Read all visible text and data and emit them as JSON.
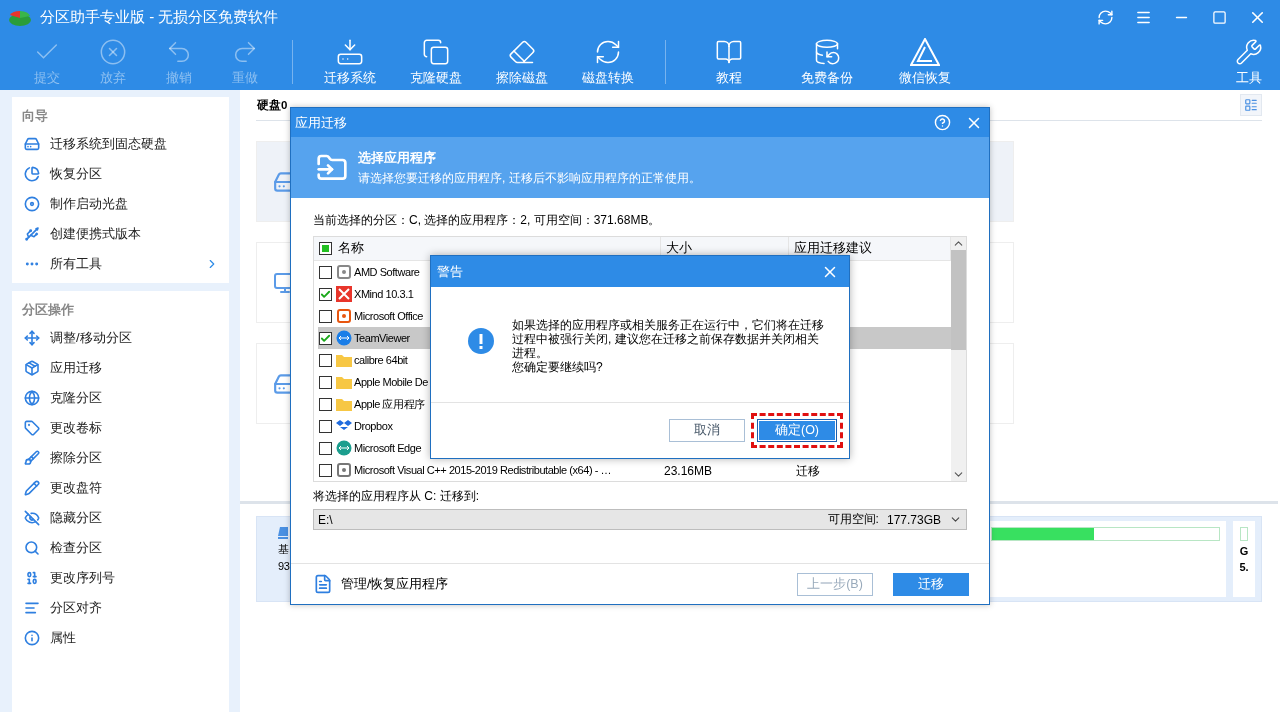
{
  "app": {
    "title": "分区助手专业版 - 无损分区免费软件"
  },
  "toolbar": {
    "groups": [
      [
        {
          "label": "提交",
          "disabled": true
        },
        {
          "label": "放弃",
          "disabled": true
        },
        {
          "label": "撤销",
          "disabled": true
        },
        {
          "label": "重做",
          "disabled": true
        }
      ],
      [
        {
          "label": "迁移系统",
          "disabled": false
        },
        {
          "label": "克隆硬盘",
          "disabled": false
        },
        {
          "label": "擦除磁盘",
          "disabled": false
        },
        {
          "label": "磁盘转换",
          "disabled": false
        }
      ],
      [
        {
          "label": "教程",
          "disabled": false
        },
        {
          "label": "免费备份",
          "disabled": false
        },
        {
          "label": "微信恢复",
          "disabled": false
        }
      ]
    ],
    "tools": {
      "label": "工具"
    }
  },
  "sidebar": {
    "sections": [
      {
        "heading": "向导",
        "items": [
          {
            "label": "迁移系统到固态硬盘",
            "has_submenu": false
          },
          {
            "label": "恢复分区",
            "has_submenu": false
          },
          {
            "label": "制作启动光盘",
            "has_submenu": false
          },
          {
            "label": "创建便携式版本",
            "has_submenu": false
          },
          {
            "label": "所有工具",
            "has_submenu": true
          }
        ]
      },
      {
        "heading": "分区操作",
        "items": [
          {
            "label": "调整/移动分区",
            "has_submenu": false
          },
          {
            "label": "应用迁移",
            "has_submenu": false
          },
          {
            "label": "克隆分区",
            "has_submenu": false
          },
          {
            "label": "更改卷标",
            "has_submenu": false
          },
          {
            "label": "擦除分区",
            "has_submenu": false
          },
          {
            "label": "更改盘符",
            "has_submenu": false
          },
          {
            "label": "隐藏分区",
            "has_submenu": false
          },
          {
            "label": "检查分区",
            "has_submenu": false
          },
          {
            "label": "更改序列号",
            "has_submenu": false
          },
          {
            "label": "分区对齐",
            "has_submenu": false
          },
          {
            "label": "属性",
            "has_submenu": false
          }
        ]
      }
    ]
  },
  "disk_view": {
    "title": "硬盘0"
  },
  "disk_panel": {
    "name": "基",
    "size": "93",
    "partition": {
      "level": 0.45
    },
    "side": {
      "letter": "G",
      "size": "5."
    }
  },
  "migrate_dialog": {
    "title": "应用迁移",
    "header": {
      "title": "选择应用程序",
      "subtitle": "请选择您要迁移的应用程序, 迁移后不影响应用程序的正常使用。"
    },
    "summary": "当前选择的分区：C, 选择的应用程序：2, 可用空间：371.68MB。",
    "check_all_mixed": true,
    "columns": [
      "名称",
      "大小",
      "应用迁移建议"
    ],
    "rows": [
      {
        "name": "AMD Software",
        "checked": false,
        "selected": false
      },
      {
        "name": "XMind 10.3.1",
        "checked": true,
        "selected": false
      },
      {
        "name": "Microsoft Office",
        "checked": false,
        "selected": false
      },
      {
        "name": "TeamViewer",
        "checked": true,
        "selected": true
      },
      {
        "name": "calibre 64bit",
        "checked": false,
        "selected": false
      },
      {
        "name": "Apple Mobile De",
        "checked": false,
        "selected": false
      },
      {
        "name": "Apple 应用程序",
        "checked": false,
        "selected": false
      },
      {
        "name": "Dropbox",
        "checked": false,
        "selected": false
      },
      {
        "name": "Microsoft Edge",
        "checked": false,
        "selected": false
      },
      {
        "name": "Microsoft Visual C++ 2015-2019 Redistributable (x64) - …",
        "checked": false,
        "selected": false,
        "size": "23.16MB",
        "advice": "迁移"
      }
    ],
    "target_label": "将选择的应用程序从 C: 迁移到:",
    "target": {
      "value": "E:\\",
      "free_label": "可用空间:",
      "free": "177.73GB"
    },
    "footer_link": "管理/恢复应用程序",
    "buttons": [
      {
        "label": "上一步(B)",
        "kind": "secondary",
        "disabled": true
      },
      {
        "label": "迁移",
        "kind": "primary",
        "disabled": false
      }
    ]
  },
  "warning_dialog": {
    "title": "警告",
    "message": "如果选择的应用程序或相关服务正在运行中，它们将在迁移过程中被强行关闭, 建议您在迁移之前保存数据并关闭相关进程。",
    "question": "您确定要继续吗?",
    "buttons": [
      {
        "label": "取消",
        "kind": "secondary",
        "focused": false
      },
      {
        "label": "确定(O)",
        "kind": "primary",
        "focused": true
      }
    ]
  }
}
